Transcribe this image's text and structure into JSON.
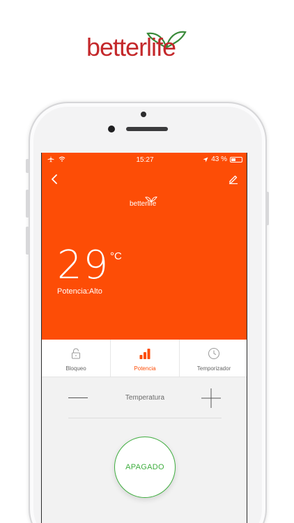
{
  "brand": {
    "logo_text": "betterlife"
  },
  "status_bar": {
    "time": "15:27",
    "battery_pct": "43 %",
    "battery_level": 0.43
  },
  "header": {
    "logo_text": "betterlife"
  },
  "heater": {
    "temperature": "29",
    "unit": "°C",
    "power_label": "Potencia:Alto"
  },
  "tabs": [
    {
      "label": "Bloqueo",
      "icon": "lock-icon",
      "active": false
    },
    {
      "label": "Potencia",
      "icon": "signal-bars-icon",
      "active": true
    },
    {
      "label": "Temporizador",
      "icon": "clock-icon",
      "active": false
    }
  ],
  "temperature_control": {
    "label": "Temperatura"
  },
  "power_button": {
    "label": "APAGADO"
  },
  "colors": {
    "accent": "#fd4d06",
    "power_green": "#3fae3f",
    "brand_red": "#c4282b",
    "brand_green": "#3a8a3a"
  }
}
